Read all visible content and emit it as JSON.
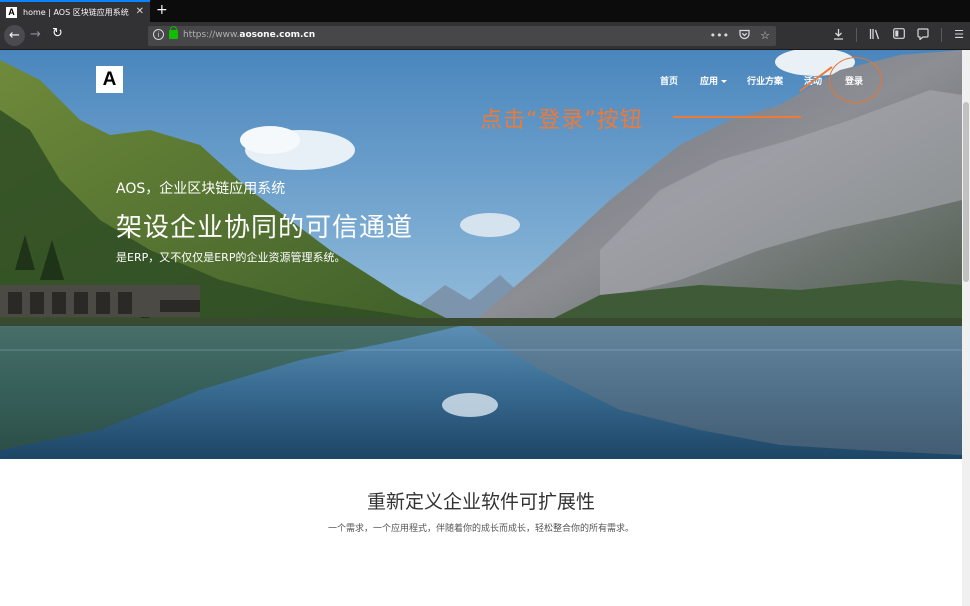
{
  "browser": {
    "tab_title": "home | AOS 区块链应用系统",
    "tab_favicon": "A",
    "tab_close": "✕",
    "new_tab": "+",
    "url_prefix": "https://www.",
    "url_domain": "aosone.com.cn",
    "url_suffix": ""
  },
  "site": {
    "logo": "A",
    "nav": {
      "home": "首页",
      "apps": "应用",
      "solutions": "行业方案",
      "events": "活动",
      "login": "登录"
    }
  },
  "annotation": {
    "text": "点击“登录”按钮",
    "color": "#ee7a36"
  },
  "hero": {
    "kicker": "AOS，企业区块链应用系统",
    "title": "架设企业协同的可信通道",
    "subtitle": "是ERP，又不仅仅是ERP的企业资源管理系统。"
  },
  "section": {
    "title": "重新定义企业软件可扩展性",
    "subtitle": "一个需求，一个应用程式，伴随着你的成长而成长，轻松整合你的所有需求。"
  },
  "icons": {
    "back": "back-arrow-icon",
    "forward": "forward-arrow-icon",
    "reload": "reload-icon",
    "info": "info-icon",
    "lock": "lock-icon",
    "page_actions": "ellipsis-icon",
    "pocket": "pocket-icon",
    "bookmark": "star-icon",
    "download": "download-icon",
    "library": "library-icon",
    "sidebar": "sidebar-icon",
    "screenshot": "speech-bubble-icon",
    "menu": "hamburger-menu-icon"
  }
}
